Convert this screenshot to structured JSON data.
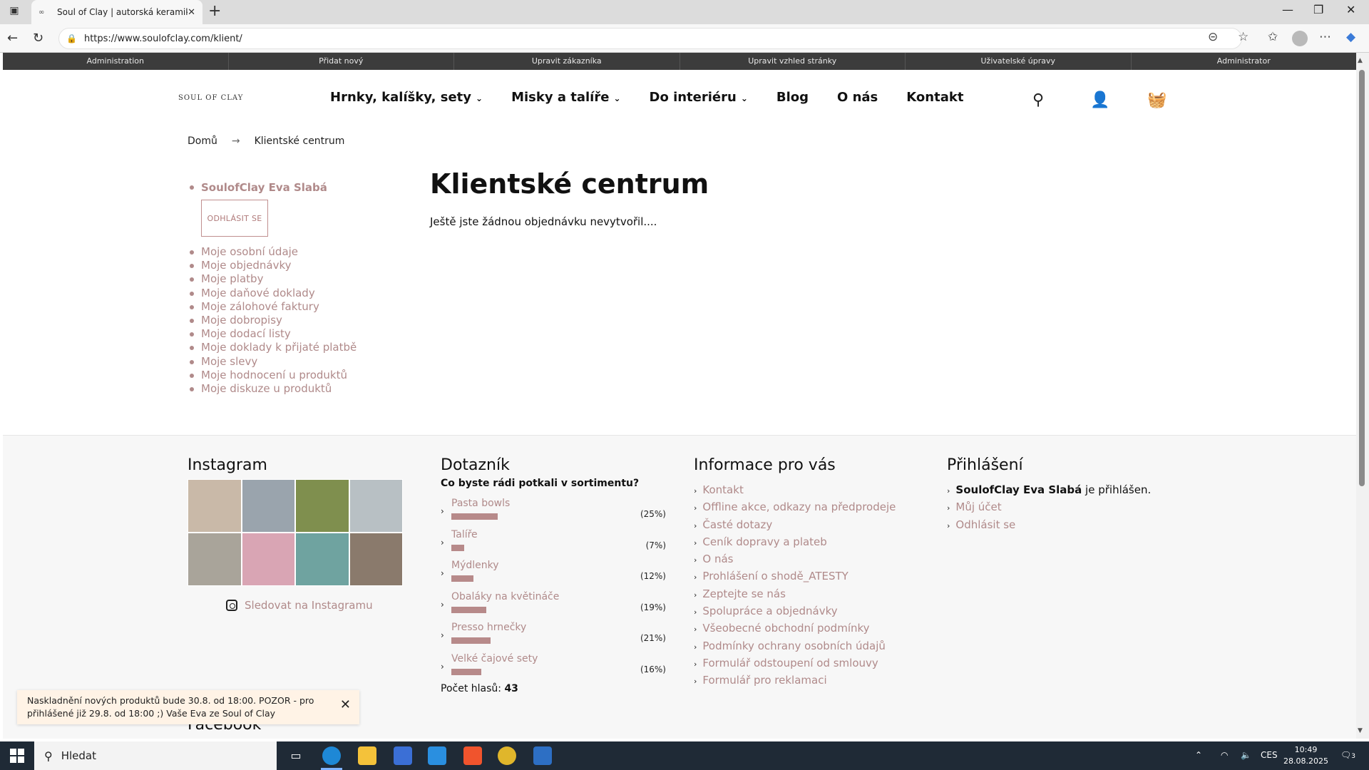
{
  "browser": {
    "tab_title": "Soul of Clay | autorská keramika",
    "url": "https://www.soulofclay.com/klient/"
  },
  "admin_bar": [
    "Administration",
    "Přidat nový",
    "Upravit zákazníka",
    "Upravit vzhled stránky",
    "Uživatelské úpravy",
    "Administrator"
  ],
  "header": {
    "logo": "SOUL OF CLAY",
    "nav": [
      {
        "label": "Hrnky, kalíšky, sety",
        "dropdown": true
      },
      {
        "label": "Misky a talíře",
        "dropdown": true
      },
      {
        "label": "Do interiéru",
        "dropdown": true
      },
      {
        "label": "Blog",
        "dropdown": false
      },
      {
        "label": "O nás",
        "dropdown": false
      },
      {
        "label": "Kontakt",
        "dropdown": false
      }
    ]
  },
  "breadcrumb": {
    "home": "Domů",
    "separator": "→",
    "current": "Klientské centrum"
  },
  "sidebar": {
    "user": "SoulofClay Eva Slabá",
    "logout": "ODHLÁSIT SE",
    "links": [
      "Moje osobní údaje",
      "Moje objednávky",
      "Moje platby",
      "Moje daňové doklady",
      "Moje zálohové faktury",
      "Moje dobropisy",
      "Moje dodací listy",
      "Moje doklady k přijaté platbě",
      "Moje slevy",
      "Moje hodnocení u produktů",
      "Moje diskuze u produktů"
    ]
  },
  "main": {
    "title": "Klientské centrum",
    "text": "Ještě jste žádnou objednávku nevytvořil...."
  },
  "footer": {
    "instagram": {
      "heading": "Instagram",
      "follow": "Sledovat na Instagramu"
    },
    "poll": {
      "heading": "Dotazník",
      "question": "Co byste rádi potkali v sortimentu?",
      "items": [
        {
          "label": "Pasta bowls",
          "pct": "(25%)",
          "value": 25
        },
        {
          "label": "Talíře",
          "pct": "(7%)",
          "value": 7
        },
        {
          "label": "Mýdlenky",
          "pct": "(12%)",
          "value": 12
        },
        {
          "label": "Obaláky na květináče",
          "pct": "(19%)",
          "value": 19
        },
        {
          "label": "Presso hrnečky",
          "pct": "(21%)",
          "value": 21
        },
        {
          "label": "Velké čajové sety",
          "pct": "(16%)",
          "value": 16
        }
      ],
      "total_label": "Počet hlasů:",
      "total": "43"
    },
    "info": {
      "heading": "Informace pro vás",
      "links": [
        "Kontakt",
        "Offline akce, odkazy na předprodeje",
        "Časté dotazy",
        "Ceník dopravy a plateb",
        "O nás",
        "Prohlášení o shodě_ATESTY",
        "Zeptejte se nás",
        "Spolupráce a objednávky",
        "Všeobecné obchodní podmínky",
        "Podmínky ochrany osobních údajů",
        "Formulář odstoupení od smlouvy",
        "Formulář pro reklamaci"
      ]
    },
    "login": {
      "heading": "Přihlášení",
      "user": "SoulofClay Eva Slabá",
      "status": " je přihlášen.",
      "account": "Můj účet",
      "logout": "Odhlásit se"
    },
    "facebook": "Facebook"
  },
  "notice": {
    "text": "Naskladnění nových produktů bude 30.8. od 18:00. POZOR - pro přihlášené již 29.8. od 18:00 ;) Vaše Eva ze Soul of Clay"
  },
  "taskbar": {
    "search": "Hledat",
    "lang": "CES",
    "time": "10:49",
    "date": "28.08.2025",
    "notif_count": "3"
  },
  "colors": {
    "accent": "#b08a8a",
    "admin_bar": "#3c3c3c",
    "bar": "#b78a8a"
  }
}
